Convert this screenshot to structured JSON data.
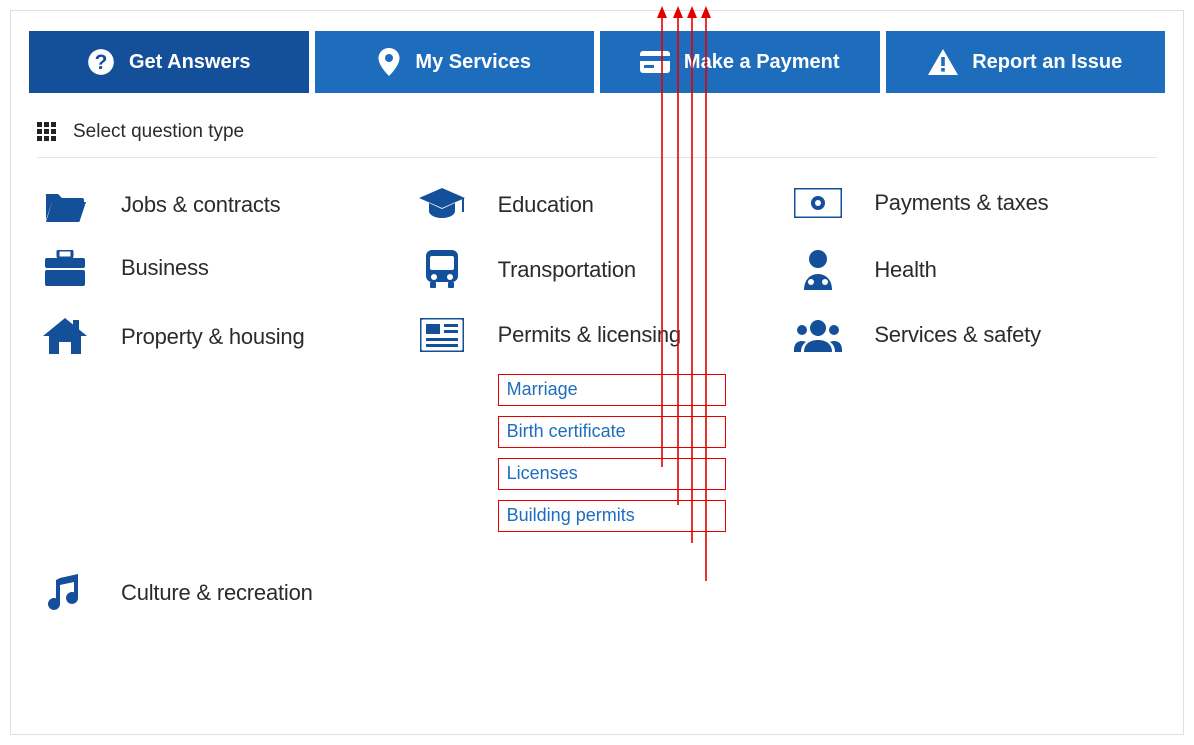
{
  "tabs": {
    "answers": "Get Answers",
    "services": "My Services",
    "payment": "Make a Payment",
    "report": "Report an Issue"
  },
  "selector_label": "Select question type",
  "categories": {
    "jobs": "Jobs & contracts",
    "education": "Education",
    "payments": "Payments & taxes",
    "business": "Business",
    "transport": "Transportation",
    "health": "Health",
    "property": "Property & housing",
    "permits": "Permits & licensing",
    "services": "Services & safety",
    "culture": "Culture & recreation"
  },
  "permits_sub": {
    "marriage": "Marriage",
    "birth": "Birth certificate",
    "licenses": "Licenses",
    "building": "Building permits"
  },
  "colors": {
    "tab_bg": "#1e6dbc",
    "tab_active_bg": "#14509a",
    "icon": "#14509a",
    "link": "#1e6dbc",
    "annotation": "#e40000"
  }
}
